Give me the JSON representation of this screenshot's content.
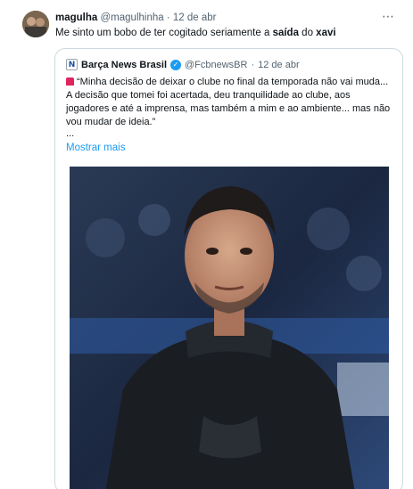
{
  "tweet": {
    "author_name": "magulha",
    "author_handle": "@magulhinha",
    "separator": "·",
    "date": "12 de abr",
    "text_before": "Me sinto um bobo de ter cogitado seriamente a ",
    "text_bold_1": "saída",
    "text_middle": " do ",
    "text_bold_2": "xavi",
    "more_label": "⋯"
  },
  "quote": {
    "logo_text": "N",
    "author_name": "Barça News Brasil",
    "author_handle": "@FcbnewsBR",
    "separator": "·",
    "date": "12 de abr",
    "body": "“Minha decisão de deixar o clube no final da temporada não vai muda... A decisão que tomei foi acertada, deu tranquilidade ao clube, aos jogadores e até a imprensa, mas também a mim e ao ambiente... mas não vou mudar de ideia.”",
    "ellipsis": "...",
    "show_more_label": "Mostrar mais"
  },
  "icons": [
    "avatar",
    "more-icon",
    "news-logo-icon",
    "verified-badge-icon",
    "siren-icon"
  ],
  "colors": {
    "link": "#1d9bf0",
    "verified": "#1d9bf0",
    "secondary_text": "#536471",
    "border": "#cfd9de"
  }
}
